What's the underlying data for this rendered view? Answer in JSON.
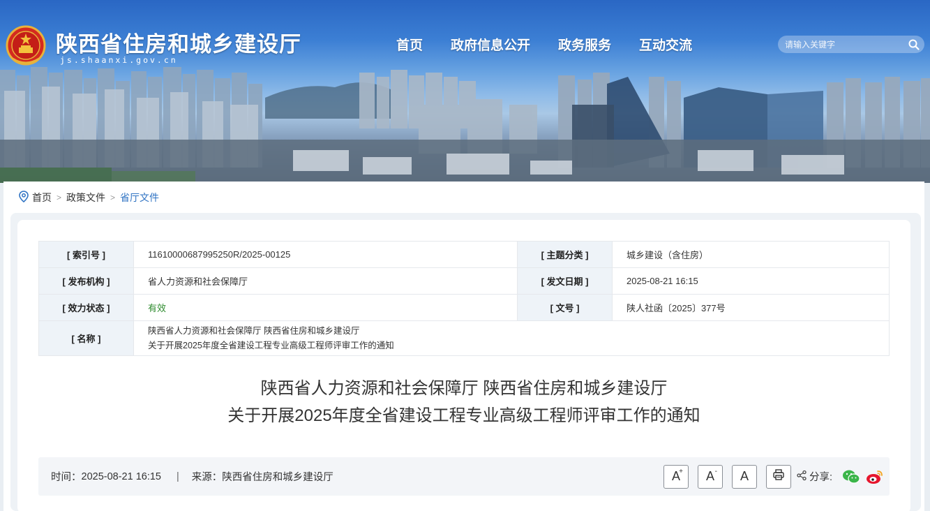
{
  "header": {
    "site_title": "陕西省住房和城乡建设厅",
    "site_domain": "js.shaanxi.gov.cn",
    "nav": [
      "首页",
      "政府信息公开",
      "政务服务",
      "互动交流"
    ],
    "search_placeholder": "请输入关键字"
  },
  "breadcrumb": [
    "首页",
    "政策文件",
    "省厅文件"
  ],
  "meta": {
    "index_no_label": "[ 索引号 ]",
    "index_no": "11610000687995250R/2025-00125",
    "topic_label": "[ 主题分类 ]",
    "topic": "城乡建设（含住房）",
    "publisher_label": "[ 发布机构 ]",
    "publisher": "省人力资源和社会保障厅",
    "date_label": "[ 发文日期 ]",
    "date": "2025-08-21 16:15",
    "status_label": "[ 效力状态 ]",
    "status": "有效",
    "doc_no_label": "[ 文号 ]",
    "doc_no": "陕人社函〔2025〕377号",
    "name_label": "[ 名称 ]",
    "name_line1": "陕西省人力资源和社会保障厅 陕西省住房和城乡建设厅",
    "name_line2": "关于开展2025年度全省建设工程专业高级工程师评审工作的通知"
  },
  "article": {
    "title_line1": "陕西省人力资源和社会保障厅 陕西省住房和城乡建设厅",
    "title_line2": "关于开展2025年度全省建设工程专业高级工程师评审工作的通知",
    "time_label": "时间：",
    "time": "2025-08-21 16:15",
    "separator": "|",
    "source_label": "来源：",
    "source": "陕西省住房和城乡建设厅",
    "font_large": "A",
    "font_small": "A",
    "font_normal": "A",
    "share_label": "分享:"
  },
  "colors": {
    "link_blue": "#2f73c3",
    "valid_green": "#2e8b2e",
    "wechat_green": "#3bb54a",
    "weibo_red": "#e6162d"
  },
  "icons": [
    "emblem-icon",
    "search-icon",
    "location-icon",
    "print-icon",
    "share-icon",
    "wechat-icon",
    "weibo-icon"
  ]
}
